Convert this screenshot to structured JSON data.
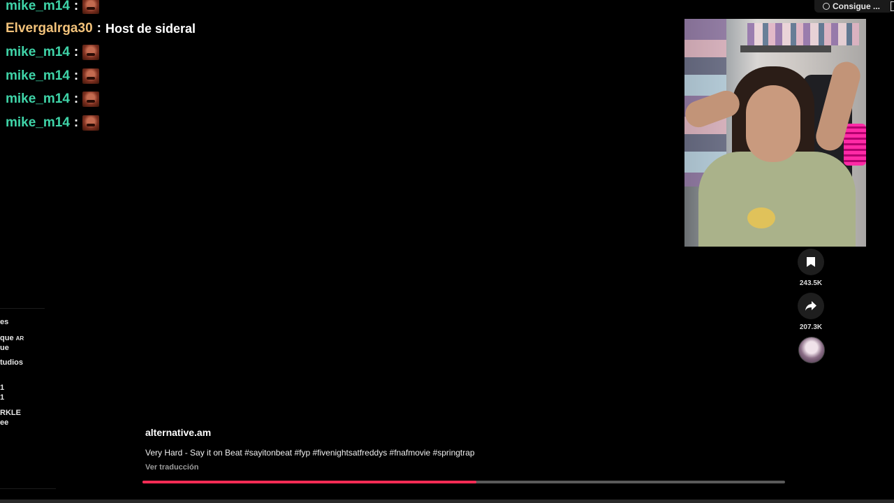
{
  "chat": {
    "lines": [
      {
        "user": "mike_m14",
        "sep": ":",
        "message": ""
      },
      {
        "user": "Elvergalrga30",
        "sep": ":",
        "message": "Host de sideral"
      },
      {
        "user": "mike_m14",
        "sep": ":",
        "message": ""
      },
      {
        "user": "mike_m14",
        "sep": ":",
        "message": ""
      },
      {
        "user": "mike_m14",
        "sep": ":",
        "message": ""
      },
      {
        "user": "mike_m14",
        "sep": ":",
        "message": ""
      }
    ]
  },
  "sidebar_fragments": [
    {
      "text": "es",
      "badge": ""
    },
    {
      "text": "que",
      "badge": "AR"
    },
    {
      "text": "ue",
      "badge": ""
    },
    {
      "text": "tudios",
      "badge": ""
    },
    {
      "text": "1",
      "badge": ""
    },
    {
      "text": "1",
      "badge": ""
    },
    {
      "text": "RKLE",
      "badge": ""
    },
    {
      "text": "ee",
      "badge": ""
    }
  ],
  "top_right": {
    "label": "Consigue ..."
  },
  "actions": {
    "save_count": "243.5K",
    "share_count": "207.3K"
  },
  "icons": {
    "save": "bookmark-icon",
    "share": "share-arrow-icon",
    "get": "coin-icon",
    "avatar": "creator-avatar"
  },
  "video": {
    "username": "alternative.am",
    "description": "Very Hard - Say it on Beat #sayitonbeat #fyp #fivenightsatfreddys #fnafmovie #springtrap",
    "translate": "Ver traducción",
    "progress": 0.52
  },
  "colors": {
    "progress": "#fe2c55",
    "chat_user_mike": "#3fd4a8",
    "chat_user_elv": "#f2c27a"
  }
}
